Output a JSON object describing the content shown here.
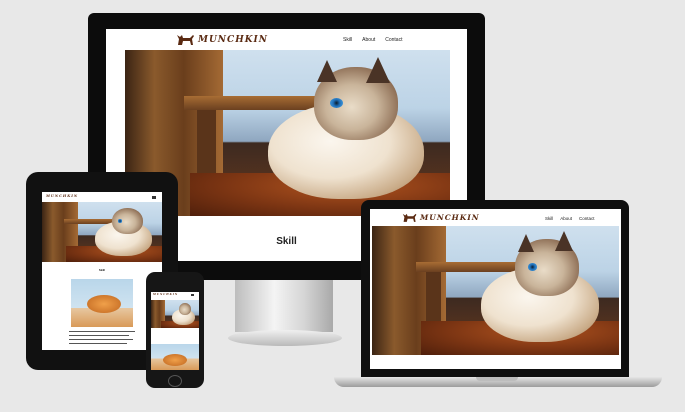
{
  "site": {
    "logo_text": "MUNCHKIN",
    "nav": [
      "Skill",
      "About",
      "Contact"
    ],
    "section_title": "Skill"
  },
  "colors": {
    "background": "#e8e8e8",
    "device_black": "#0c0c0c",
    "logo_brown": "#5a2a12"
  },
  "icons": {
    "logo": "cat-silhouette-icon",
    "menu": "hamburger-menu-icon"
  }
}
